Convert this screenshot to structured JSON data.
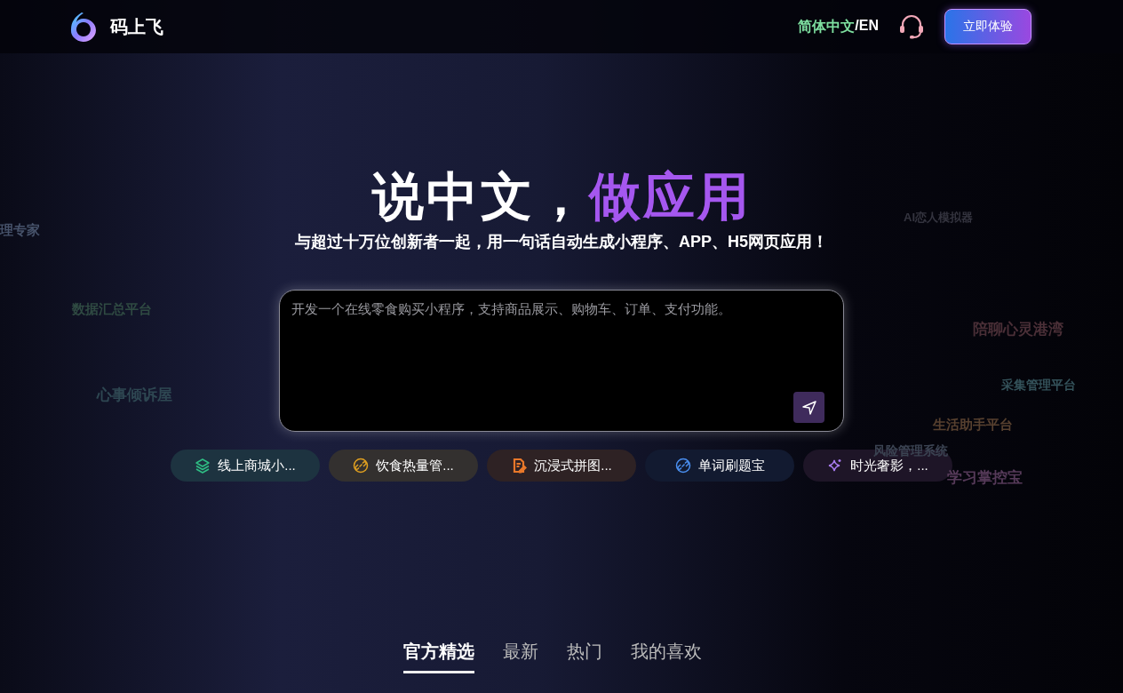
{
  "header": {
    "brand": "码上飞",
    "language_options": [
      {
        "label": "简体中文",
        "selected": true
      },
      {
        "label": "EN",
        "selected": false
      }
    ],
    "language_separator": "/",
    "cta_button": "立即体验"
  },
  "floating_apps": [
    {
      "label": "理专家",
      "color": "#46526a"
    },
    {
      "label": "数据汇总平台",
      "color": "#2f4a42"
    },
    {
      "label": "心事倾诉屋",
      "color": "#2e4752"
    },
    {
      "label": "AI恋人模拟器",
      "color": "#34343f"
    },
    {
      "label": "陪聊心灵港湾",
      "color": "#4a2f37"
    },
    {
      "label": "采集管理平台",
      "color": "#34525a"
    },
    {
      "label": "生活助手平台",
      "color": "#57402f"
    },
    {
      "label": "风险管理系统",
      "color": "#3b4352"
    },
    {
      "label": "学习掌控宝",
      "color": "#563a59"
    }
  ],
  "hero": {
    "title": "说中文，",
    "title_highlight": "做应用",
    "subtitle": "与超过十万位创新者一起，用一句话自动生成小程序、APP、H5网页应用！"
  },
  "prompt": {
    "placeholder": "开发一个在线零食购买小程序，支持商品展示、购物车、订单、支付功能。"
  },
  "suggestions": [
    {
      "label": "线上商城小...",
      "color": "#2fbf84"
    },
    {
      "label": "饮食热量管...",
      "color": "#e0a020"
    },
    {
      "label": "沉浸式拼图...",
      "color": "#e8782a"
    },
    {
      "label": "单词刷题宝",
      "color": "#4a8ff0"
    },
    {
      "label": "时光奢影，...",
      "color": "#a87cf0"
    }
  ],
  "tabs": [
    {
      "label": "官方精选",
      "selected": true
    },
    {
      "label": "最新",
      "selected": false
    },
    {
      "label": "热门",
      "selected": false
    },
    {
      "label": "我的喜欢",
      "selected": false
    }
  ]
}
